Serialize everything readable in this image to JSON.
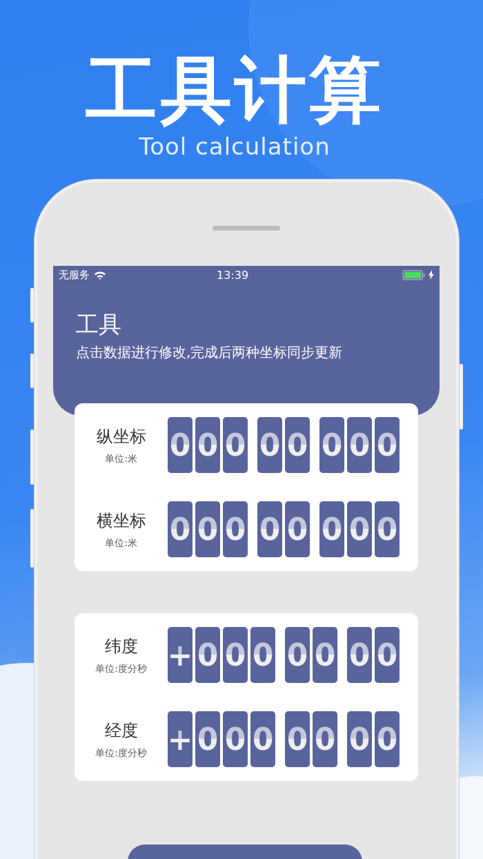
{
  "promo": {
    "title": "工具计算",
    "subtitle": "Tool calculation"
  },
  "status_bar": {
    "carrier": "无服务",
    "time": "13:39"
  },
  "header": {
    "title": "工具",
    "subtitle": "点击数据进行修改,完成后两种坐标同步更新"
  },
  "cards": [
    {
      "rows": [
        {
          "label": "纵坐标",
          "unit": "单位:米",
          "groups": [
            [
              "0",
              "0",
              "0"
            ],
            [
              "0",
              "0"
            ],
            [
              "0",
              "0",
              "0"
            ]
          ]
        },
        {
          "label": "横坐标",
          "unit": "单位:米",
          "groups": [
            [
              "0",
              "0",
              "0"
            ],
            [
              "0",
              "0"
            ],
            [
              "0",
              "0",
              "0"
            ]
          ]
        }
      ]
    },
    {
      "rows": [
        {
          "label": "纬度",
          "unit": "单位:度分秒",
          "groups": [
            [
              "+",
              "0",
              "0",
              "0"
            ],
            [
              "0",
              "0"
            ],
            [
              "0",
              "0"
            ]
          ]
        },
        {
          "label": "经度",
          "unit": "单位:度分秒",
          "groups": [
            [
              "+",
              "0",
              "0",
              "0"
            ],
            [
              "0",
              "0"
            ],
            [
              "0",
              "0"
            ]
          ]
        }
      ]
    }
  ]
}
